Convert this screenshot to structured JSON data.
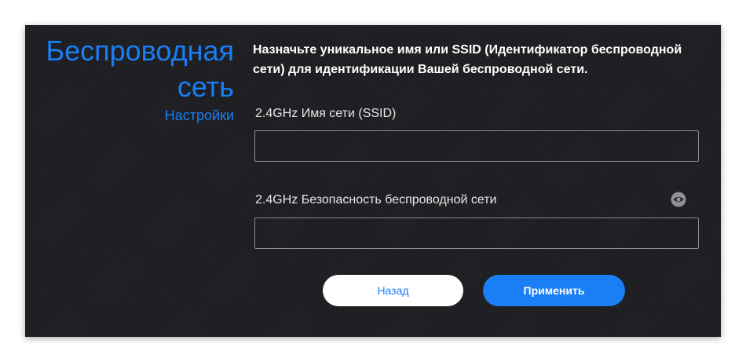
{
  "side": {
    "title_line1": "Беспроводная",
    "title_line2": "сеть",
    "subtitle": "Настройки"
  },
  "instruction": "Назначьте уникальное имя или SSID (Идентификатор беспроводной сети) для идентификации Вашей беспроводной сети.",
  "fields": {
    "ssid": {
      "label": "2.4GHz Имя сети (SSID)",
      "value": ""
    },
    "security": {
      "label": "2.4GHz Безопасность беспроводной сети",
      "value": "",
      "toggle_icon": "eye-icon"
    }
  },
  "buttons": {
    "back": "Назад",
    "apply": "Применить"
  },
  "colors": {
    "accent": "#1a7ef5",
    "background": "#1f2023",
    "text": "#ffffff"
  }
}
